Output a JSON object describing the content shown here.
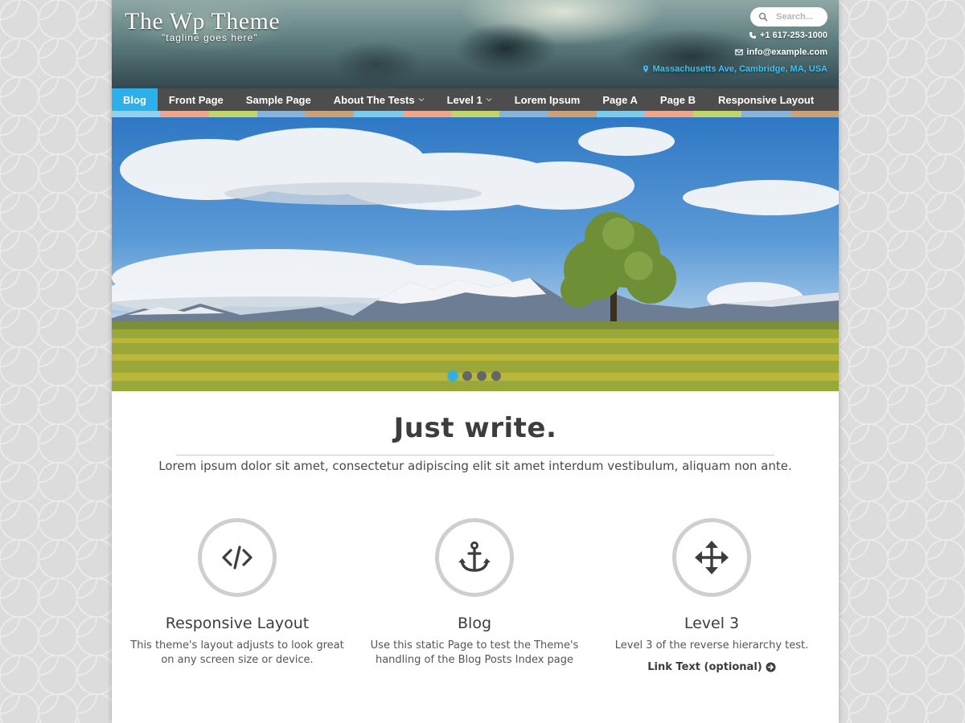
{
  "header": {
    "logo": "The Wp Theme",
    "tagline": "\"tagline goes here\"",
    "search_placeholder": "Search...",
    "phone": "+1 617-253-1000",
    "email": "info@example.com",
    "address": "Massachusetts Ave, Cambridge, MA, USA"
  },
  "nav": {
    "items": [
      {
        "label": "Blog"
      },
      {
        "label": "Front Page"
      },
      {
        "label": "Sample Page"
      },
      {
        "label": "About The Tests"
      },
      {
        "label": "Level 1"
      },
      {
        "label": "Lorem Ipsum"
      },
      {
        "label": "Page A"
      },
      {
        "label": "Page B"
      },
      {
        "label": "Responsive Layout"
      }
    ],
    "active": "Blog"
  },
  "stripe_colors": [
    "#8fd1ee",
    "#f0a68c",
    "#c3d46a",
    "#8bb3d8",
    "#c9a27a",
    "#7ccce9",
    "#f0a68c",
    "#c3d46a",
    "#8bb3d8",
    "#c9a27a",
    "#7ccce9",
    "#f0a68c",
    "#c3d46a",
    "#8bb3d8",
    "#c9a27a"
  ],
  "slider": {
    "slide_count": 4,
    "active_slide": 1
  },
  "intro": {
    "title": "Just write.",
    "subtitle": "Lorem ipsum dolor sit amet, consectetur adipiscing elit sit amet interdum vestibulum, aliquam non ante."
  },
  "features": [
    {
      "icon": "code-icon",
      "title": "Responsive Layout",
      "text": "This theme's layout adjusts to look great on any screen size or device."
    },
    {
      "icon": "anchor-icon",
      "title": "Blog",
      "text": "Use this static Page to test the Theme's handling of the Blog Posts Index page"
    },
    {
      "icon": "arrows-move-icon",
      "title": "Level 3",
      "text": "Level 3 of the reverse hierarchy test.",
      "link": "Link Text (optional)"
    }
  ],
  "colors": {
    "accent": "#2bb0ec",
    "nav_bg": "#4d4d4d",
    "text": "#3d3d3d"
  }
}
